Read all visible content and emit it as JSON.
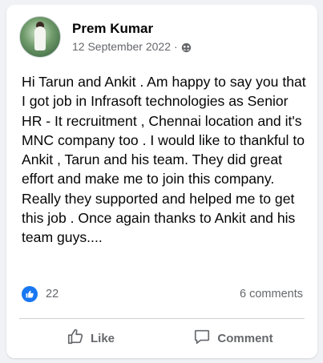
{
  "post": {
    "author": "Prem Kumar",
    "date": "12 September 2022",
    "separator": "·",
    "audience_icon": "audience-icon",
    "text": "Hi Tarun and Ankit . Am happy to say you that I got job in Infrasoft technologies as Senior HR - It recruitment , Chennai location and it's MNC company too . I would like to thankful to Ankit , Tarun and his team. They did great effort and make me to join this company. Really they supported and helped me to get this job . Once again thanks to Ankit and his team guys....",
    "reactions": {
      "icon": "like-reaction-icon",
      "count": "22"
    },
    "comments_count": "6 comments"
  },
  "actions": {
    "like_label": "Like",
    "comment_label": "Comment"
  },
  "colors": {
    "accent": "#1877f2",
    "secondary_text": "#65676b",
    "primary_text": "#050505"
  }
}
